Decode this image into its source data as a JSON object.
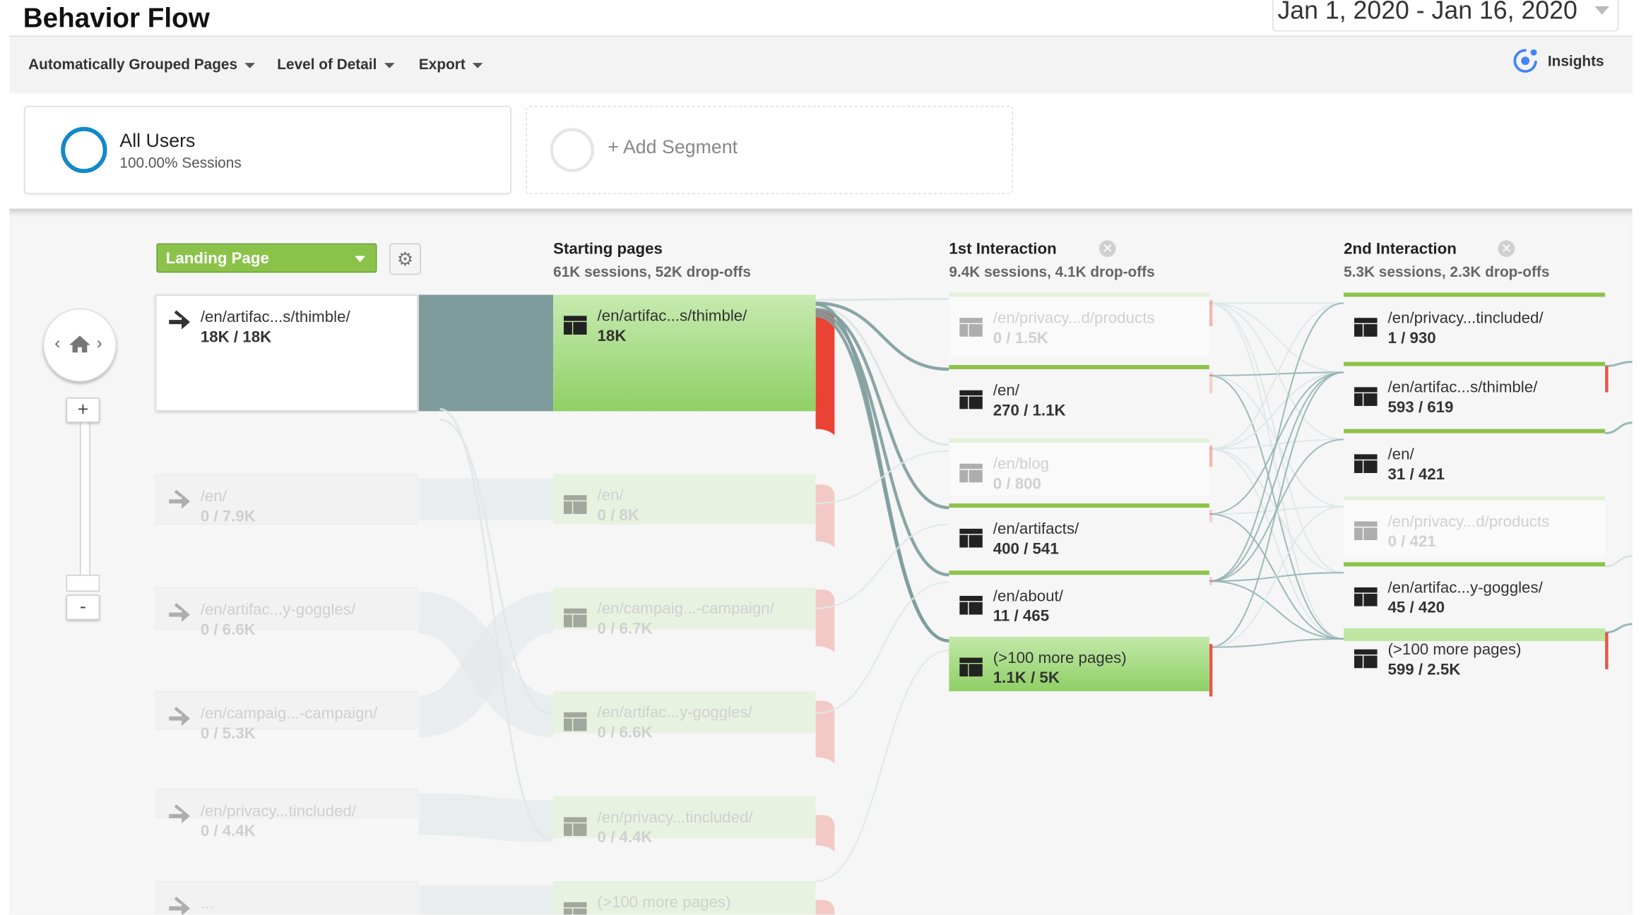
{
  "header": {
    "title": "Behavior Flow",
    "date_range": "Jan 1, 2020 - Jan 16, 2020"
  },
  "toolbar": {
    "grouped_pages": "Automatically Grouped Pages",
    "level_of_detail": "Level of Detail",
    "export": "Export",
    "insights": "Insights"
  },
  "segments": {
    "primary_name": "All Users",
    "primary_sub": "100.00% Sessions",
    "add_label": "+ Add Segment"
  },
  "flow": {
    "dimension": "Landing Page",
    "columns": [
      {
        "title": "Starting pages",
        "sub": "61K sessions, 52K drop-offs"
      },
      {
        "title": "1st Interaction",
        "sub": "9.4K sessions, 4.1K drop-offs"
      },
      {
        "title": "2nd Interaction",
        "sub": "5.3K sessions, 2.3K drop-offs"
      }
    ],
    "landing": [
      {
        "label": "/en/artifac...s/thimble/",
        "value": "18K / 18K"
      },
      {
        "label": "/en/",
        "value": "0 / 7.9K"
      },
      {
        "label": "/en/artifac...y-goggles/",
        "value": "0 / 6.6K"
      },
      {
        "label": "/en/campaig...-campaign/",
        "value": "0 / 5.3K"
      },
      {
        "label": "/en/privacy...tincluded/",
        "value": "0 / 4.4K"
      },
      {
        "label": "...",
        "value": ""
      }
    ],
    "starting": [
      {
        "label": "/en/artifac...s/thimble/",
        "value": "18K"
      },
      {
        "label": "/en/",
        "value": "0 / 8K"
      },
      {
        "label": "/en/campaig...-campaign/",
        "value": "0 / 6.7K"
      },
      {
        "label": "/en/artifac...y-goggles/",
        "value": "0 / 6.6K"
      },
      {
        "label": "/en/privacy...tincluded/",
        "value": "0 / 4.4K"
      },
      {
        "label": "(>100 more pages)",
        "value": ""
      }
    ],
    "first": [
      {
        "label": "/en/privacy...d/products",
        "value": "0 / 1.5K"
      },
      {
        "label": "/en/",
        "value": "270 / 1.1K"
      },
      {
        "label": "/en/blog",
        "value": "0 / 800"
      },
      {
        "label": "/en/artifacts/",
        "value": "400 / 541"
      },
      {
        "label": "/en/about/",
        "value": "11 / 465"
      },
      {
        "label": "(>100 more pages)",
        "value": "1.1K / 5K"
      }
    ],
    "second": [
      {
        "label": "/en/privacy...tincluded/",
        "value": "1 / 930"
      },
      {
        "label": "/en/artifac...s/thimble/",
        "value": "593 / 619"
      },
      {
        "label": "/en/",
        "value": "31 / 421"
      },
      {
        "label": "/en/privacy...d/products",
        "value": "0 / 421"
      },
      {
        "label": "/en/artifac...y-goggles/",
        "value": "45 / 420"
      },
      {
        "label": "(>100 more pages)",
        "value": "599 / 2.5K"
      }
    ]
  },
  "colors": {
    "accent_green": "#8bc34a",
    "dropoff_red": "#ea4335",
    "flow_teal": "#7f9c9c",
    "segment_blue": "#1389c9"
  }
}
